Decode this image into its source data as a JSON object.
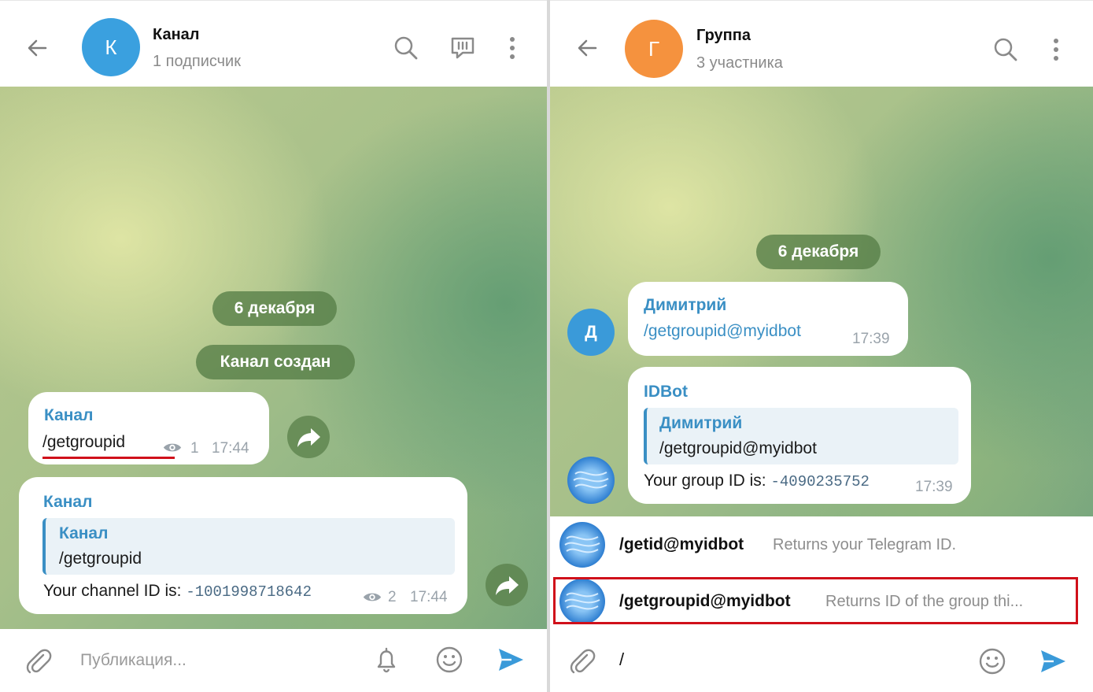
{
  "left": {
    "title": "Канал",
    "subtitle": "1 подписчик",
    "avatar_letter": "К",
    "avatar_color": "#3aa0df",
    "date_pill": "6 декабря",
    "service_pill": "Канал создан",
    "messages": [
      {
        "sender": "Канал",
        "text": "/getgroupid",
        "views": "1",
        "time": "17:44"
      },
      {
        "sender": "Канал",
        "quote_sender": "Канал",
        "quote_text": "/getgroupid",
        "text": "Your channel ID is: ",
        "value": "-1001998718642",
        "views": "2",
        "time": "17:44"
      }
    ],
    "composer_placeholder": "Публикация..."
  },
  "right": {
    "title": "Группа",
    "subtitle": "3 участника",
    "avatar_letter": "Г",
    "avatar_color": "#f5923e",
    "date_pill": "6 декабря",
    "messages": [
      {
        "sender": "Димитрий",
        "text": "/getgroupid@myidbot",
        "time": "17:39",
        "avatar_letter": "Д",
        "avatar_color": "#3a9ad9"
      },
      {
        "sender": "IDBot",
        "quote_sender": "Димитрий",
        "quote_text": "/getgroupid@myidbot",
        "text": "Your group ID is: ",
        "value": "-4090235752",
        "time": "17:39"
      }
    ],
    "commands": [
      {
        "name": "/getid@myidbot",
        "desc": "Returns your Telegram ID."
      },
      {
        "name": "/getgroupid@myidbot",
        "desc": "Returns ID of the group thi..."
      }
    ],
    "composer_value": "/"
  },
  "colors": {
    "accent": "#3a8fc4",
    "send": "#3a9ad9",
    "highlight": "#d0101a"
  }
}
